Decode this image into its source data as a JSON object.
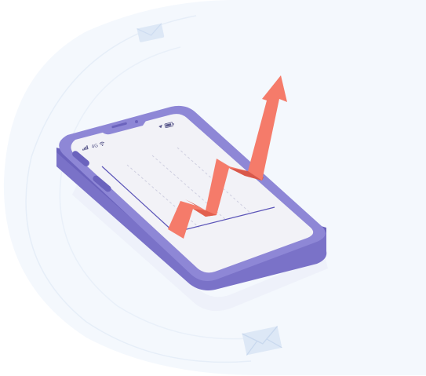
{
  "status_bar": {
    "network_label": "4G"
  },
  "colors": {
    "background_tint": "#f4f8fd",
    "phone_frame": "#8e87d6",
    "phone_frame_dark": "#6b63bd",
    "phone_screen": "#f2f2f7",
    "chart_axis": "#5b54b8",
    "gridline": "#cfcfe0",
    "arrow": "#f57b6a",
    "arrow_shadow": "#d9584a",
    "envelope": "#dde8f6"
  },
  "icons": [
    "signal-bars-icon",
    "wifi-icon",
    "location-arrow-icon",
    "battery-icon",
    "envelope-icon",
    "growth-arrow-icon"
  ]
}
